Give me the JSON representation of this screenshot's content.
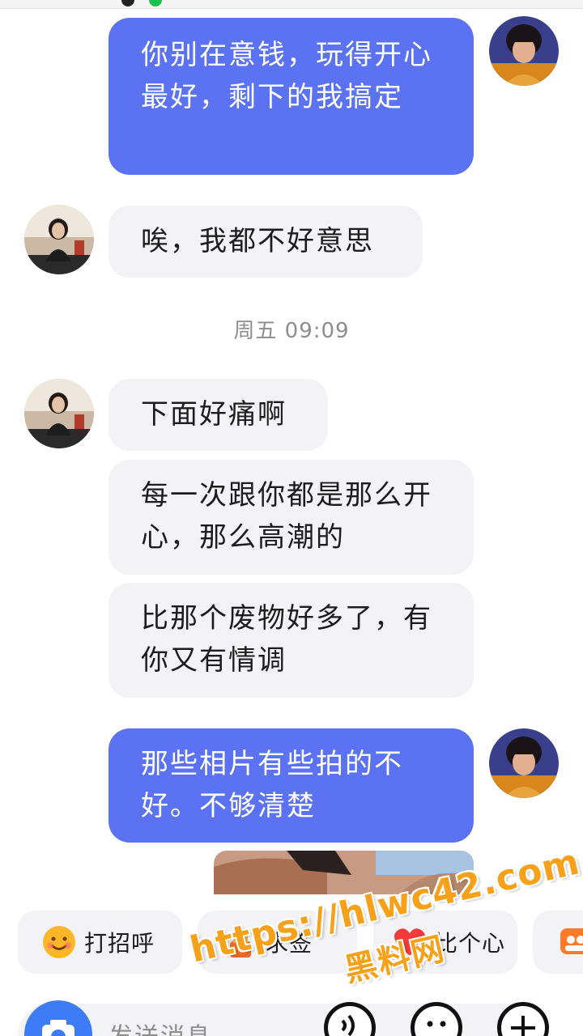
{
  "timestamp": "周五 09:09",
  "messages": {
    "m1": "你别在意钱，玩得开心最好，剩下的我搞定",
    "m2": "唉，我都不好意思",
    "m3": "下面好痛啊",
    "m4": "每一次跟你都是那么开心，那么高潮的",
    "m5": "比那个废物好多了，有你又有情调",
    "m6": "那些相片有些拍的不好。不够清楚"
  },
  "quick_actions": [
    "打招呼",
    "求签",
    "比个心"
  ],
  "input": {
    "placeholder": "发送消息"
  },
  "watermark": {
    "url": "https://hlwc42.com",
    "site": "黑料网"
  },
  "colors": {
    "my_bubble": "#5b73f3",
    "their_bubble": "#f3f3f5",
    "camera": "#3d7cf5",
    "watermark": "#f7a11a"
  }
}
